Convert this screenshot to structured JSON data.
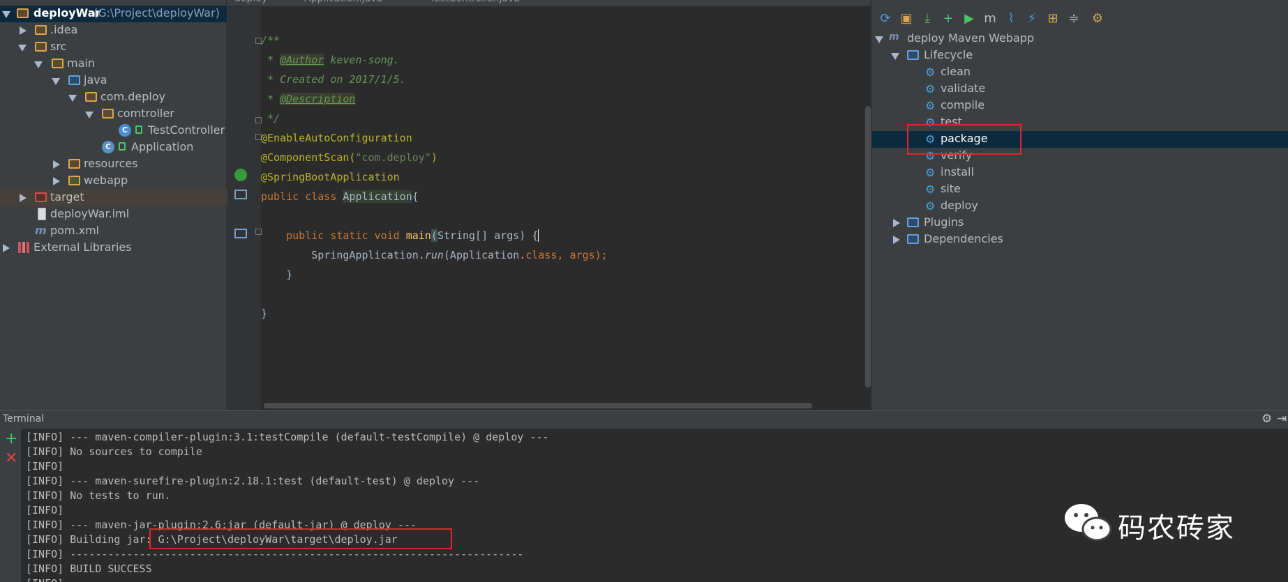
{
  "project_tree": {
    "root_name": "deployWar",
    "root_path": "(G:\\Project\\deployWar)",
    "items": [
      {
        "label": ".idea"
      },
      {
        "label": "src"
      },
      {
        "label": "main"
      },
      {
        "label": "java"
      },
      {
        "label": "com.deploy"
      },
      {
        "label": "comtroller"
      },
      {
        "label": "TestController"
      },
      {
        "label": "Application"
      },
      {
        "label": "resources"
      },
      {
        "label": "webapp"
      },
      {
        "label": "target"
      },
      {
        "label": "deployWar.iml"
      },
      {
        "label": "pom.xml"
      },
      {
        "label": "External Libraries"
      }
    ]
  },
  "editor": {
    "tabs": [
      "deploy",
      "Application.java",
      "TestController.java"
    ],
    "lines": {
      "l1": "/**",
      "l2a": " * ",
      "l2b": "@Author",
      "l2c": " keven-song.",
      "l3": " * Created on 2017/1/5.",
      "l4a": " * ",
      "l4b": "@Description",
      "l5": " */",
      "l6": "@EnableAutoConfiguration",
      "l7a": "@ComponentScan(",
      "l7b": "\"com.deploy\"",
      "l7c": ")",
      "l8": "@SpringBootApplication",
      "l9a": "public class ",
      "l9b": "Application",
      "l9c": "{",
      "l11a": "    public static void ",
      "l11b": "main",
      "l11c": "(",
      "l11d": "String[] args",
      "l11e": ") {",
      "l12a": "        SpringApplication.",
      "l12b": "run",
      "l12c": "(Application.",
      "l12d": "class",
      "l12e": ", args);",
      "l13": "    }",
      "l15": "}"
    }
  },
  "maven": {
    "project": "deploy Maven Webapp",
    "lifecycle_label": "Lifecycle",
    "phases": [
      "clean",
      "validate",
      "compile",
      "test",
      "package",
      "verify",
      "install",
      "site",
      "deploy"
    ],
    "plugins_label": "Plugins",
    "dependencies_label": "Dependencies",
    "selected_phase": "package"
  },
  "terminal": {
    "title": "Terminal",
    "lines": [
      "[INFO] --- maven-compiler-plugin:3.1:testCompile (default-testCompile) @ deploy ---",
      "[INFO] No sources to compile",
      "[INFO]",
      "[INFO] --- maven-surefire-plugin:2.18.1:test (default-test) @ deploy ---",
      "[INFO] No tests to run.",
      "[INFO]",
      "[INFO] --- maven-jar-plugin:2.6:jar (default-jar) @ deploy ---",
      "[INFO] Building jar: G:\\Project\\deployWar\\target\\deploy.jar",
      "[INFO] ------------------------------------------------------------------------",
      "[INFO] BUILD SUCCESS",
      "[INFO] ------------------------------------------------------------------------"
    ]
  },
  "watermark": {
    "text": "码农砖家"
  },
  "colors": {
    "highlight_box": "#e0262b",
    "selection": "#0d293e"
  }
}
